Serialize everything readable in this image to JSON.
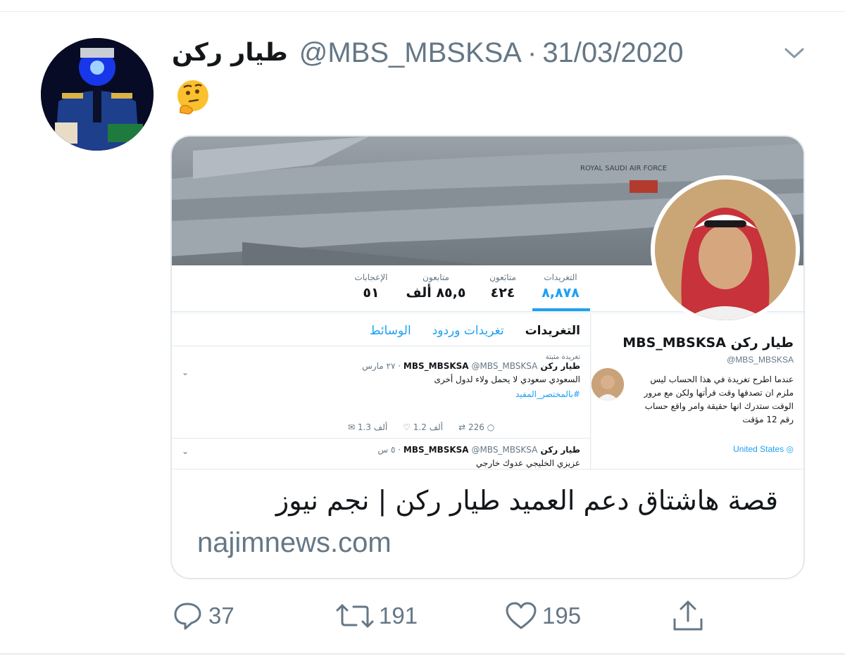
{
  "tweet": {
    "author_name": "طيار ركن",
    "handle": "@MBS_MBSKSA",
    "separator": "·",
    "date": "31/03/2020",
    "emoji": "🤔"
  },
  "card": {
    "title": "قصة هاشتاق دعم العميد طيار ركن | نجم نيوز",
    "domain": "najimnews.com",
    "preview": {
      "banner_text": "ROYAL SAUDI AIR FORCE",
      "stats": [
        {
          "label": "التغريدات",
          "value": "٨,٨٧٨"
        },
        {
          "label": "متابَعون",
          "value": "٤٢٤"
        },
        {
          "label": "متابعون",
          "value": "٨٥,٥ ألف"
        },
        {
          "label": "الإعجابات",
          "value": "٥١"
        }
      ],
      "tabs": [
        "التغريدات",
        "تغريدات وردود",
        "الوسائط"
      ],
      "pinned_label": "تغريدة مثبتة",
      "tweet1": {
        "name": "طيار ركن MBS_MBSKSA",
        "handle": "@MBS_MBSKSA",
        "date": "٢٧ مارس",
        "text": "السعودي سعودي لا يحمل ولاء لدول أخرى",
        "hashtag": "#بالمختصر_المفيد",
        "replies": "226",
        "retweets": "1.2 ألف",
        "likes": "1.3 ألف"
      },
      "tweet2": {
        "name": "طيار ركن MBS_MBSKSA",
        "handle": "@MBS_MBSKSA",
        "date": "٥ س",
        "text": "عزيزي الخليجي عدوك خارجي"
      },
      "profile": {
        "name": "طيار ركن MBS_MBSKSA",
        "handle": "@MBS_MBSKSA",
        "bio": "عندما اطرح تغريدة في هذا الحساب ليس ملزم ان تصدقها وقت قرأتها ولكن مع مرور الوقت ستدرك انها حقيقة وامر واقع حساب رقم 12 مؤقت",
        "location": "United States"
      }
    }
  },
  "actions": {
    "replies": "37",
    "retweets": "191",
    "likes": "195"
  },
  "colors": {
    "accent": "#1da1f2",
    "secondary_text": "#657786",
    "border": "#e1e8ed"
  }
}
